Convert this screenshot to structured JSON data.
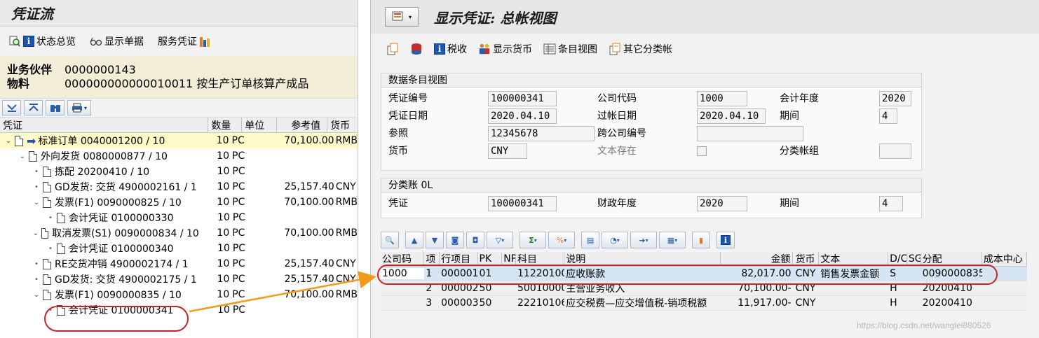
{
  "left": {
    "title": "凭证流",
    "toolbar": {
      "status_overview": "状态总览",
      "display_doc": "显示单据",
      "service_doc": "服务凭证"
    },
    "partner": {
      "bp_label": "业务伙伴",
      "bp_value": "0000000143",
      "material_label": "物料",
      "material_value": "000000000000010011 按生产订单核算产成品"
    },
    "columns": [
      "凭证",
      "数量",
      "单位",
      "参考值",
      "货币"
    ],
    "rows": [
      {
        "indent": 0,
        "marker": "caret",
        "arrow": true,
        "doc": "标准订单 0040001200 / 10",
        "qty": "10",
        "unit": "PC",
        "ref": "70,100.00",
        "cur": "RMB",
        "hl": true
      },
      {
        "indent": 1,
        "marker": "caret",
        "arrow": false,
        "doc": "外向发货 0080000877 / 10",
        "qty": "10",
        "unit": "PC",
        "ref": "",
        "cur": "",
        "hl": false
      },
      {
        "indent": 2,
        "marker": "bullet",
        "arrow": false,
        "doc": "拣配 20200410 / 10",
        "qty": "10",
        "unit": "PC",
        "ref": "",
        "cur": "",
        "hl": false
      },
      {
        "indent": 2,
        "marker": "bullet",
        "arrow": false,
        "doc": "GD发货: 交货 4900002161 / 1",
        "qty": "10",
        "unit": "PC",
        "ref": "25,157.40",
        "cur": "CNY",
        "hl": false
      },
      {
        "indent": 2,
        "marker": "caret",
        "arrow": false,
        "doc": "发票(F1) 0090000825 / 10",
        "qty": "10",
        "unit": "PC",
        "ref": "70,100.00",
        "cur": "RMB",
        "hl": false
      },
      {
        "indent": 3,
        "marker": "bullet",
        "arrow": false,
        "doc": "会计凭证 0100000330",
        "qty": "10",
        "unit": "PC",
        "ref": "",
        "cur": "",
        "hl": false
      },
      {
        "indent": 2,
        "marker": "caret",
        "arrow": false,
        "doc": "取消发票(S1) 0090000834 / 10",
        "qty": "10",
        "unit": "PC",
        "ref": "70,100.00",
        "cur": "RMB",
        "hl": false
      },
      {
        "indent": 3,
        "marker": "bullet",
        "arrow": false,
        "doc": "会计凭证 0100000340",
        "qty": "10",
        "unit": "PC",
        "ref": "",
        "cur": "",
        "hl": false
      },
      {
        "indent": 2,
        "marker": "bullet",
        "arrow": false,
        "doc": "RE交货冲销 4900002174 / 1",
        "qty": "10",
        "unit": "PC",
        "ref": "25,157.40",
        "cur": "CNY",
        "hl": false
      },
      {
        "indent": 2,
        "marker": "bullet",
        "arrow": false,
        "doc": "GD发货: 交货 4900002175 / 1",
        "qty": "10",
        "unit": "PC",
        "ref": "25,157.40",
        "cur": "CNY",
        "hl": false
      },
      {
        "indent": 2,
        "marker": "caret",
        "arrow": false,
        "doc": "发票(F1) 0090000835 / 10",
        "qty": "10",
        "unit": "PC",
        "ref": "70,100.00",
        "cur": "RMB",
        "hl": false
      },
      {
        "indent": 3,
        "marker": "bullet",
        "arrow": false,
        "doc": "会计凭证 0100000341",
        "qty": "10",
        "unit": "PC",
        "ref": "",
        "cur": "",
        "hl": false
      }
    ]
  },
  "right": {
    "title": "显示凭证: 总帐视图",
    "toolbar": {
      "tax": "税收",
      "display_currency": "显示货币",
      "entry_view": "条目视图",
      "other_ledger": "其它分类帐"
    },
    "entry_group": {
      "title": "数据条目视图",
      "doc_no_label": "凭证编号",
      "doc_no": "100000341",
      "company_label": "公司代码",
      "company": "1000",
      "fiscal_year_label": "会计年度",
      "fiscal_year": "2020",
      "doc_date_label": "凭证日期",
      "doc_date": "2020.04.10",
      "post_date_label": "过帐日期",
      "post_date": "2020.04.10",
      "period_label": "期间",
      "period": "4",
      "ref_label": "参照",
      "ref": "12345678",
      "cross_co_label": "跨公司编号",
      "cross_co": "",
      "currency_label": "货币",
      "currency": "CNY",
      "text_exists_label": "文本存在",
      "ledger_group_label": "分类帐组",
      "ledger_group": ""
    },
    "ledger_group": {
      "title": "分类账 0L",
      "doc_label": "凭证",
      "doc": "100000341",
      "fiscal_year_label": "财政年度",
      "fiscal_year": "2020",
      "period_label": "期间",
      "period": "4"
    },
    "grid": {
      "headers": [
        "公司码",
        "项",
        "行项目",
        "PK",
        "NP",
        "科目",
        "说明",
        "金额",
        "货币",
        "文本",
        "D/C",
        "SG",
        "分配",
        "成本中心"
      ],
      "rows": [
        {
          "bukrs": "1000",
          "item": "1",
          "line": "000001",
          "pk": "01",
          "np": "",
          "gl": "11220100",
          "desc": "应收账款",
          "amt": "82,017.00",
          "cur": "CNY",
          "text": "销售发票金额",
          "dc": "S",
          "sg": "",
          "asg": "0090000835",
          "cc": ""
        },
        {
          "bukrs": "",
          "item": "2",
          "line": "000002",
          "pk": "50",
          "np": "",
          "gl": "50010000",
          "desc": "主营业务收入",
          "amt": "70,100.00-",
          "cur": "CNY",
          "text": "",
          "dc": "H",
          "sg": "",
          "asg": "20200410",
          "cc": ""
        },
        {
          "bukrs": "",
          "item": "3",
          "line": "000003",
          "pk": "50",
          "np": "",
          "gl": "22210106",
          "desc": "应交税费—应交增值税-销项税额",
          "amt": "11,917.00-",
          "cur": "CNY",
          "text": "",
          "dc": "H",
          "sg": "",
          "asg": "20200410",
          "cc": ""
        }
      ]
    },
    "watermark": "https://blog.csdn.net/wanglei880526"
  },
  "colors": {
    "highlight_row": "#fffac8",
    "selected_row": "#d5e5f3",
    "callout": "#c0262b",
    "connector_arrow": "#f39a1e",
    "info_blue": "#1c56b4"
  }
}
